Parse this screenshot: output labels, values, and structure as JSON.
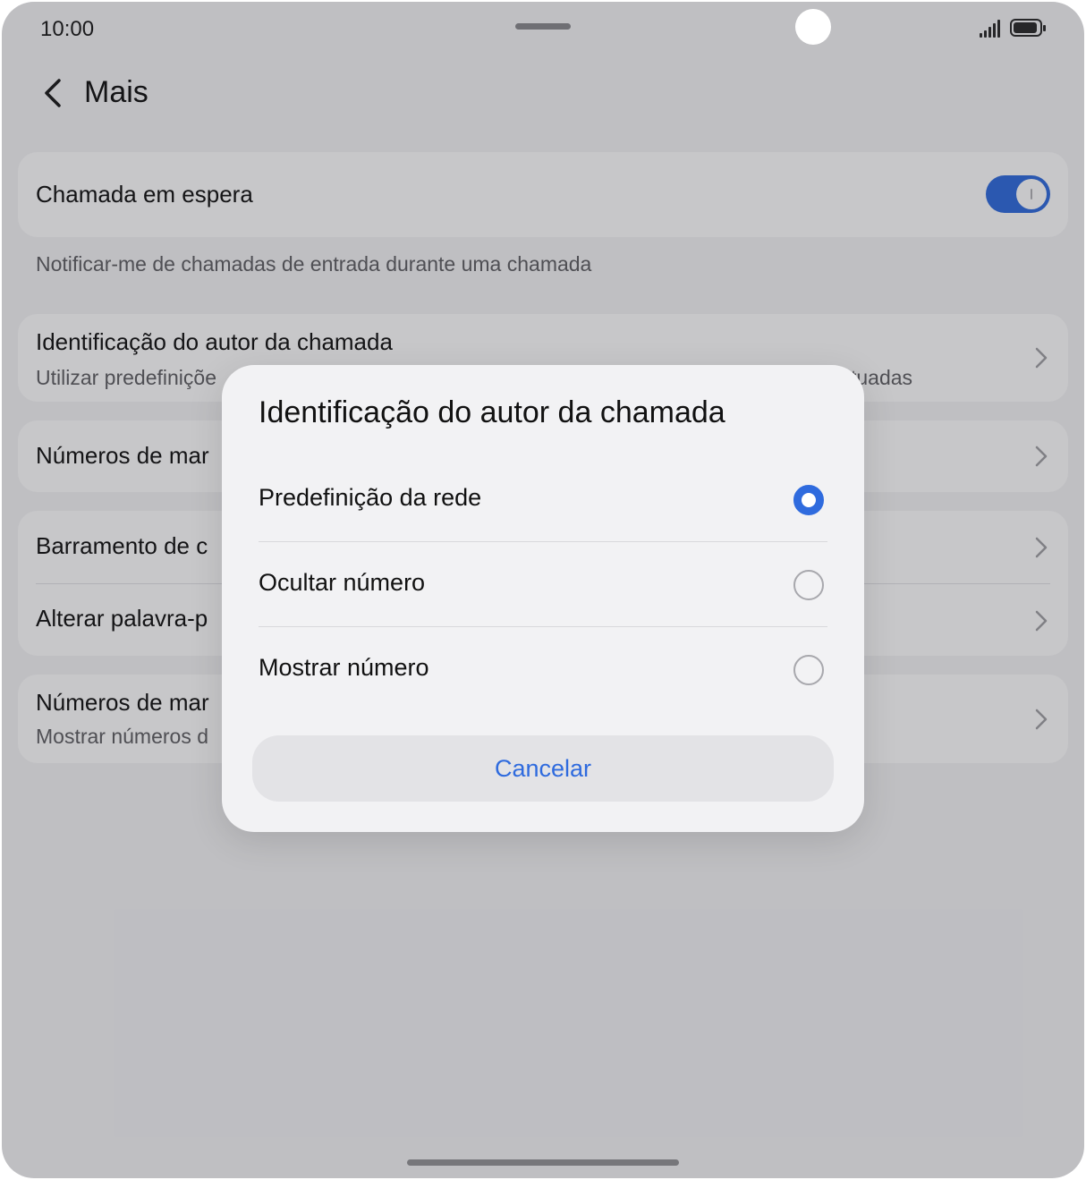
{
  "status_bar": {
    "time": "10:00",
    "icons": [
      "signal-icon",
      "battery-icon"
    ]
  },
  "header": {
    "back_icon": "chevron-left-icon",
    "title": "Mais"
  },
  "call_waiting": {
    "label": "Chamada em espera",
    "enabled": true,
    "hint": "Notificar-me de chamadas de entrada durante uma chamada"
  },
  "settings_rows": [
    {
      "title": "Identificação do autor da chamada",
      "subtitle_left": "Utilizar predefiniçõe",
      "subtitle_right": "tuadas"
    },
    {
      "title": "Números de mar"
    },
    {
      "title": "Barramento de c"
    },
    {
      "title": "Alterar palavra-p"
    },
    {
      "title": "Números de mar",
      "subtitle_left": "Mostrar números d"
    }
  ],
  "dialog": {
    "title": "Identificação do autor da chamada",
    "options": [
      {
        "label": "Predefinição da rede",
        "selected": true
      },
      {
        "label": "Ocultar número",
        "selected": false
      },
      {
        "label": "Mostrar número",
        "selected": false
      }
    ],
    "cancel_label": "Cancelar"
  },
  "colors": {
    "accent": "#2f6bde",
    "background": "#f4f4f6",
    "card": "#ffffff"
  }
}
